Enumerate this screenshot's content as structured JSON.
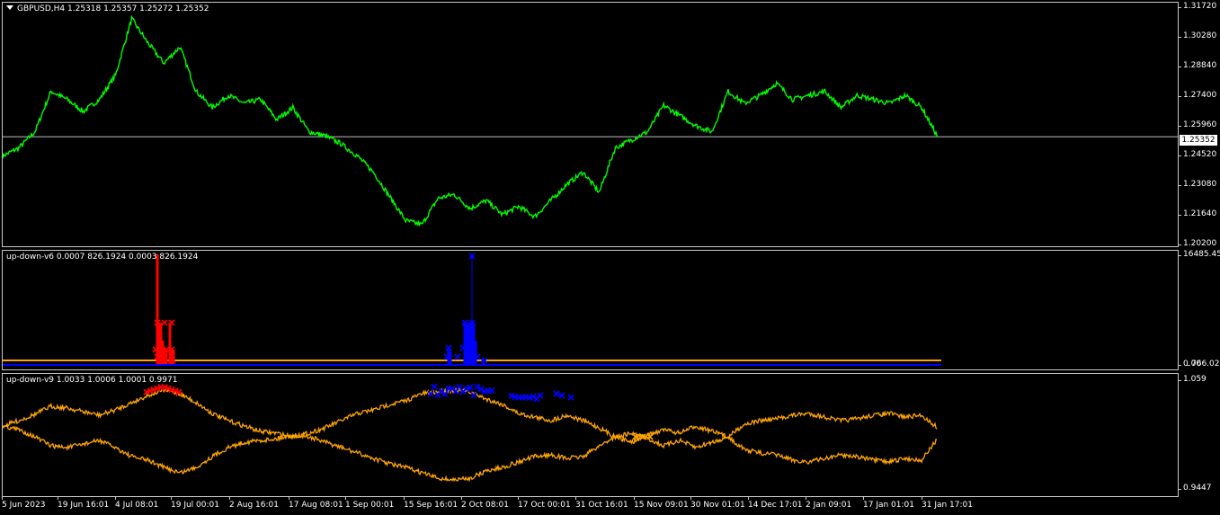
{
  "main": {
    "label": "GBPUSD,H4  1.25318 1.25357 1.25272 1.25352",
    "current_price": "1.25352",
    "yticks": [
      "1.31720",
      "1.30280",
      "1.28840",
      "1.27400",
      "1.25960",
      "1.24520",
      "1.23080",
      "1.21640",
      "1.20200"
    ],
    "line_color": "#00ff00",
    "price_line_color": "#c0c0c0"
  },
  "v6": {
    "label": "up-down-v6 0.0007 826.1924 0.0003 826.1924",
    "yticks": [
      "16485.450",
      "766.0214"
    ],
    "yticks_overlap": "0.00",
    "colors": {
      "up": "#ff0000",
      "down": "#0000ff",
      "baseline": "#ffa500"
    }
  },
  "v9": {
    "label": "up-down-v9 1.0033 1.0006 1.0001 0.9971",
    "yticks": [
      "1.059",
      "0.9447"
    ],
    "colors": {
      "band": "#ffa500",
      "up": "#ff0000",
      "down": "#0000ff"
    }
  },
  "xaxis": {
    "labels": [
      "5 Jun 2023",
      "19 Jun 16:01",
      "4 Jul 08:01",
      "19 Jul 00:01",
      "2 Aug 16:01",
      "17 Aug 08:01",
      "1 Sep 00:01",
      "15 Sep 16:01",
      "2 Oct 08:01",
      "17 Oct 00:01",
      "31 Oct 16:01",
      "15 Nov 09:01",
      "30 Nov 01:01",
      "14 Dec 17:01",
      "2 Jan 09:01",
      "17 Jan 01:01",
      "31 Jan 17:01"
    ]
  },
  "chart_data": {
    "type": "line",
    "series": [
      {
        "name": "GBPUSD,H4",
        "values": [
          1.244,
          1.248,
          1.256,
          1.276,
          1.272,
          1.266,
          1.272,
          1.284,
          1.312,
          1.3,
          1.29,
          1.298,
          1.276,
          1.268,
          1.274,
          1.27,
          1.272,
          1.262,
          1.268,
          1.256,
          1.254,
          1.25,
          1.244,
          1.236,
          1.224,
          1.212,
          1.21,
          1.223,
          1.225,
          1.218,
          1.222,
          1.215,
          1.219,
          1.214,
          1.222,
          1.23,
          1.236,
          1.226,
          1.248,
          1.252,
          1.256,
          1.269,
          1.264,
          1.259,
          1.256,
          1.276,
          1.27,
          1.274,
          1.28,
          1.272,
          1.274,
          1.276,
          1.268,
          1.274,
          1.272,
          1.27,
          1.274,
          1.268,
          1.2535
        ]
      }
    ],
    "ylim": [
      1.202,
      1.3172
    ]
  }
}
